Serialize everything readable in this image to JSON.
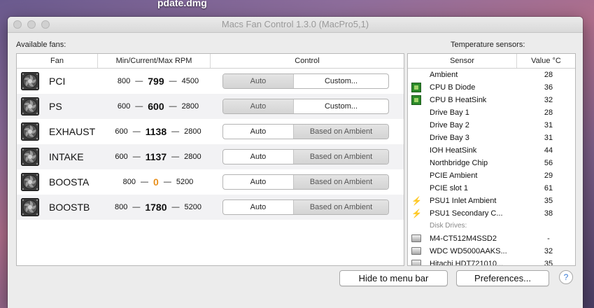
{
  "desktop": {
    "filename": "pdate.dmg"
  },
  "window": {
    "title": "Macs Fan Control 1.3.0 (MacPro5,1)"
  },
  "fans_panel": {
    "label": "Available fans:",
    "columns": {
      "fan": "Fan",
      "rpm": "Min/Current/Max RPM",
      "control": "Control"
    },
    "dash": "—",
    "rows": [
      {
        "name": "PCI",
        "min": "800",
        "current": "799",
        "max": "4500",
        "auto": "Auto",
        "other": "Custom...",
        "selected": "auto"
      },
      {
        "name": "PS",
        "min": "600",
        "current": "600",
        "max": "2800",
        "auto": "Auto",
        "other": "Custom...",
        "selected": "auto"
      },
      {
        "name": "EXHAUST",
        "min": "600",
        "current": "1138",
        "max": "2800",
        "auto": "Auto",
        "other": "Based on Ambient",
        "selected": "other"
      },
      {
        "name": "INTAKE",
        "min": "600",
        "current": "1137",
        "max": "2800",
        "auto": "Auto",
        "other": "Based on Ambient",
        "selected": "other"
      },
      {
        "name": "BOOSTA",
        "min": "800",
        "current": "0",
        "max": "5200",
        "auto": "Auto",
        "other": "Based on Ambient",
        "selected": "other"
      },
      {
        "name": "BOOSTB",
        "min": "800",
        "current": "1780",
        "max": "5200",
        "auto": "Auto",
        "other": "Based on Ambient",
        "selected": "other"
      }
    ]
  },
  "sensors_panel": {
    "label": "Temperature sensors:",
    "columns": {
      "sensor": "Sensor",
      "value": "Value °C"
    },
    "rows": [
      {
        "name": "Ambient",
        "value": "28",
        "icon": ""
      },
      {
        "name": "CPU B Diode",
        "value": "36",
        "icon": "chip-icon"
      },
      {
        "name": "CPU B HeatSink",
        "value": "32",
        "icon": "chip-icon"
      },
      {
        "name": "Drive Bay 1",
        "value": "28",
        "icon": ""
      },
      {
        "name": "Drive Bay 2",
        "value": "31",
        "icon": ""
      },
      {
        "name": "Drive Bay 3",
        "value": "31",
        "icon": ""
      },
      {
        "name": "IOH HeatSink",
        "value": "44",
        "icon": ""
      },
      {
        "name": "Northbridge Chip",
        "value": "56",
        "icon": ""
      },
      {
        "name": "PCIE Ambient",
        "value": "29",
        "icon": ""
      },
      {
        "name": "PCIE slot 1",
        "value": "61",
        "icon": ""
      },
      {
        "name": "PSU1 Inlet Ambient",
        "value": "35",
        "icon": "bolt-icon"
      },
      {
        "name": "PSU1 Secondary C...",
        "value": "38",
        "icon": "bolt-icon"
      }
    ],
    "disk_group_label": "Disk Drives:",
    "disk_rows": [
      {
        "name": "M4-CT512M4SSD2",
        "value": "-",
        "icon": "ssd-icon"
      },
      {
        "name": "WDC WD5000AAKS...",
        "value": "32",
        "icon": "hdd-icon"
      },
      {
        "name": "Hitachi HDT721010...",
        "value": "35",
        "icon": "hdd-icon"
      }
    ]
  },
  "buttons": {
    "hide_to_menu_bar": "Hide to menu bar",
    "preferences": "Preferences...",
    "help": "?"
  }
}
